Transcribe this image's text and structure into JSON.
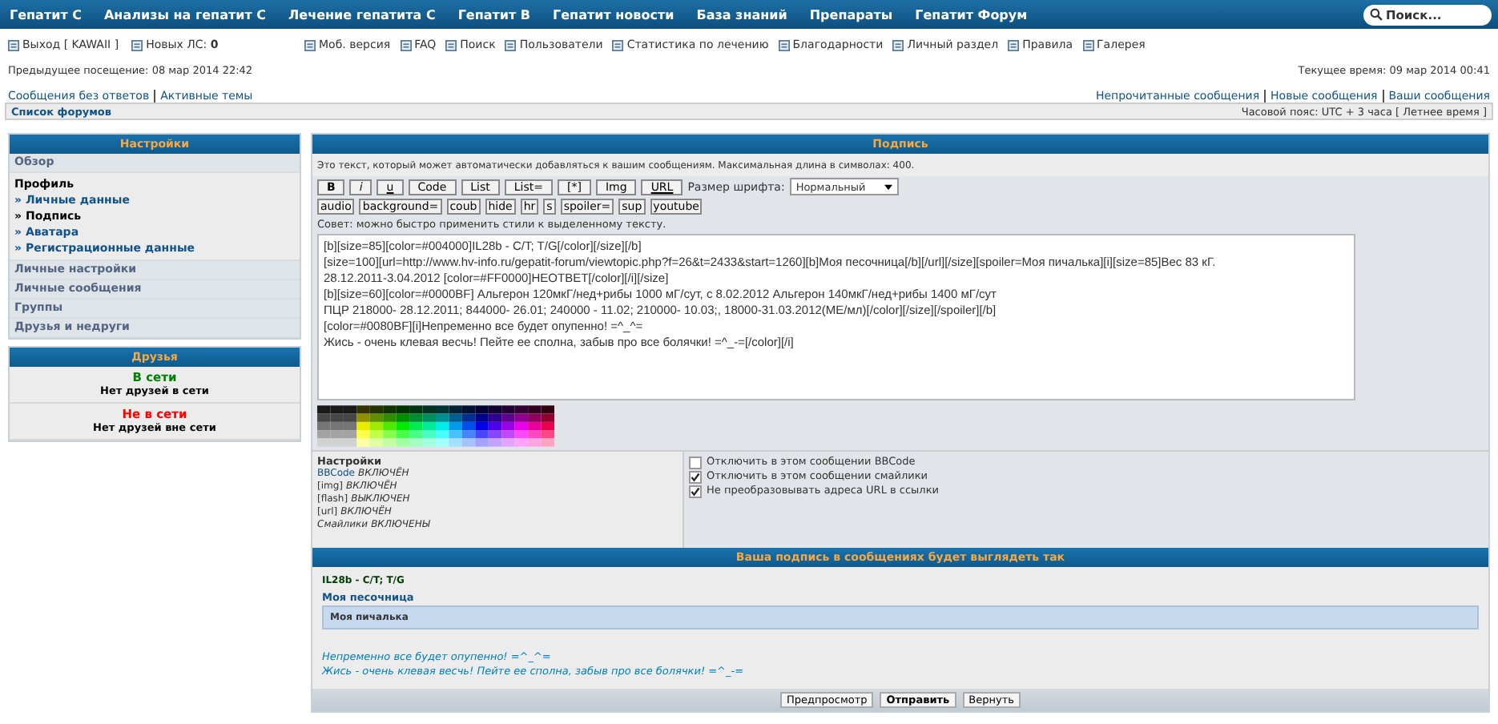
{
  "nav": {
    "items": [
      "Гепатит С",
      "Анализы на гепатит С",
      "Лечение гепатита С",
      "Гепатит В",
      "Гепатит новости",
      "База знаний",
      "Препараты",
      "Гепатит Форум"
    ],
    "search": {
      "placeholder": "Поиск..."
    }
  },
  "user_links": [
    {
      "label": "Выход [ KAWAII ]"
    },
    {
      "label": "Новых ЛС: **0**"
    }
  ],
  "site_links": [
    "Моб. версия",
    "FAQ",
    "Поиск",
    "Пользователи",
    "Статистика по лечению",
    "Благодарности",
    "Личный раздел",
    "Правила",
    "Галерея"
  ],
  "last_visit": "Предыдущее посещение: 08 мар 2014 22:42",
  "current_time": "Текущее время: 09 мар 2014 00:41",
  "quick_links_left": [
    "Сообщения без ответов",
    "Активные темы"
  ],
  "quick_links_right": [
    "Непрочитанные сообщения",
    "Новые сообщения",
    "Ваши сообщения"
  ],
  "breadcrumb": "Список форумов",
  "timezone": "Часовой пояс: UTC + 3 часа [ Летнее время ]",
  "sidebar": {
    "title": "Настройки",
    "sections": [
      {
        "label": "Обзор",
        "expanded": false
      },
      {
        "label": "Профиль",
        "expanded": true,
        "children": [
          {
            "label": "» Личные данные",
            "selected": false
          },
          {
            "label": "» Подпись",
            "selected": true
          },
          {
            "label": "» Аватара",
            "selected": false
          },
          {
            "label": "» Регистрационные данные",
            "selected": false
          }
        ]
      },
      {
        "label": "Личные настройки",
        "expanded": false
      },
      {
        "label": "Личные сообщения",
        "expanded": false
      },
      {
        "label": "Группы",
        "expanded": false
      },
      {
        "label": "Друзья и недруги",
        "expanded": false
      }
    ]
  },
  "friends": {
    "title": "Друзья",
    "groups": [
      {
        "status": "В сети",
        "color": "#008000",
        "note": "Нет друзей в сети"
      },
      {
        "status": "Не в сети",
        "color": "#ff0000",
        "note": "Нет друзей вне сети"
      }
    ]
  },
  "signature": {
    "title": "Подпись",
    "description": "Это текст, который может автоматически добавляться к вашим сообщениям. Максимальная длина в символах: 400.",
    "format_buttons": [
      {
        "label": "B",
        "kind": "bold"
      },
      {
        "label": "i",
        "kind": "italic"
      },
      {
        "label": "u",
        "kind": "underline"
      },
      {
        "label": "Code",
        "kind": "plain"
      },
      {
        "label": "List",
        "kind": "plain"
      },
      {
        "label": "List=",
        "kind": "plain"
      },
      {
        "label": "[*]",
        "kind": "plain"
      },
      {
        "label": "Img",
        "kind": "plain"
      },
      {
        "label": "URL",
        "kind": "underline"
      }
    ],
    "font_size_label": "Размер шрифта:",
    "font_size_value": "Нормальный",
    "extra_buttons": [
      "audio",
      "background=",
      "coub",
      "hide",
      "hr",
      "s",
      "spoiler=",
      "sup",
      "youtube"
    ],
    "tip": "Совет: можно быстро применить стили к выделенному тексту.",
    "text_lines": [
      "[b][size=85][color=#004000]IL28b - C/T; T/G[/color][/size][/b]",
      "[size=100][url=http://www.hv-info.ru/gepatit-forum/viewtopic.php?f=26&t=2433&start=1260][b]Моя песочница[/b][/url][/size][spoiler=Моя пичалька][i][size=85]Вес 83 кГ.",
      "28.12.2011-3.04.2012 [color=#FF0000]НЕОТВЕТ[/color][/i][/size]",
      "[b][size=60][color=#0000BF] Альгерон 120мкГ/нед+рибы 1000 мГ/сут, с 8.02.2012 Альгерон 140мкГ/нед+рибы 1400 мГ/сут",
      "ПЦР 218000- 28.12.2011; 844000- 26.01; 240000 - 11.02; 210000- 10.03;, 18000-31.03.2012(МЕ/мл)[/color][/size][/spoiler][/b]",
      "[color=#0080BF][i]Непременно все будет опупенно! =^_^=",
      "Жись - очень клевая весчь! Пейте ее сполна, забыв про все болячки! =^_-=[/color][/i]"
    ],
    "settings_title": "Настройки",
    "settings": [
      {
        "label": "BBCode",
        "status": "ВКЛЮЧЁН",
        "kind": "link"
      },
      {
        "label": "[img]",
        "status": "ВКЛЮЧЁН",
        "kind": "plain"
      },
      {
        "label": "[flash]",
        "status": "ВЫКЛЮЧЕН",
        "kind": "plain"
      },
      {
        "label": "[url]",
        "status": "ВКЛЮЧЁН",
        "kind": "plain"
      },
      {
        "label": "Смайлики",
        "status": "ВКЛЮЧЕНЫ",
        "kind": "italic"
      }
    ],
    "options": [
      {
        "label": "Отключить в этом сообщении BBCode",
        "checked": false
      },
      {
        "label": "Отключить в этом сообщении смайлики",
        "checked": true
      },
      {
        "label": "Не преобразовывать адреса URL в ссылки",
        "checked": true
      }
    ]
  },
  "preview": {
    "title": "Ваша подпись в сообщениях будет выглядеть так",
    "items": [
      {
        "text": "IL28b - C/T; T/G",
        "kind": "text",
        "color": "#004000"
      },
      {
        "text": "Моя песочница",
        "kind": "link",
        "color": "#105289"
      },
      {
        "text": "Моя пичалька",
        "kind": "spoiler",
        "color": "#333333"
      },
      {
        "text": "Непременно все будет опупенно! =^_^=",
        "kind": "italic",
        "color": "#0080bf"
      },
      {
        "text": "Жись - очень клевая весчь! Пейте ее сполна, забыв про все болячки! =^_-=",
        "kind": "italic",
        "color": "#0080bf"
      }
    ]
  },
  "buttons": [
    {
      "label": "Предпросмотр",
      "kind": "normal"
    },
    {
      "label": "Отправить",
      "kind": "primary"
    },
    {
      "label": "Вернуть",
      "kind": "normal"
    }
  ]
}
